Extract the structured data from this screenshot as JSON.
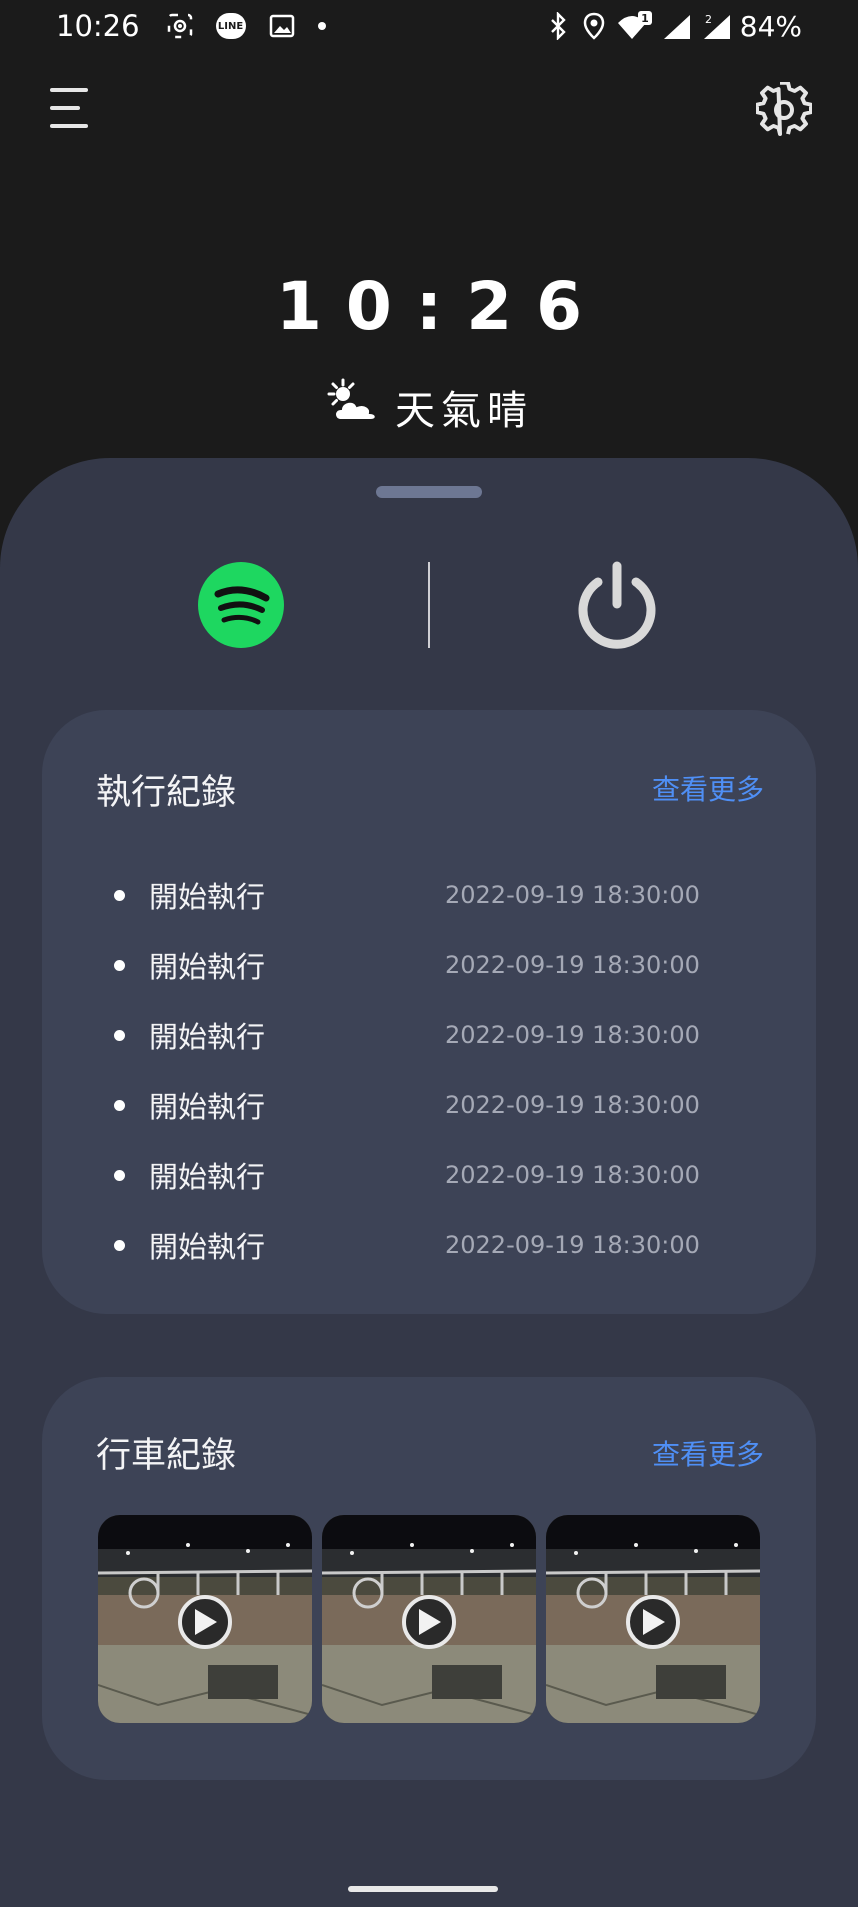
{
  "status_bar": {
    "time": "10:26",
    "battery": "84%",
    "line_label": "LINE",
    "sim1_badge": "1",
    "sim2_badge": "2",
    "left_icons": [
      "screenshot-icon",
      "line-icon",
      "gallery-icon",
      "dot-icon"
    ],
    "right_icons": [
      "bluetooth-icon",
      "location-icon",
      "wifi-icon",
      "signal-icon",
      "signal-icon"
    ]
  },
  "header": {
    "menu_icon": "menu-icon",
    "settings_icon": "gear-icon"
  },
  "clock": {
    "time": "10:26"
  },
  "weather": {
    "icon": "partly-sunny-icon",
    "text": "天氣晴"
  },
  "quick_actions": {
    "music_icon": "spotify-icon",
    "power_icon": "power-icon",
    "colors": {
      "spotify": "#1ed760",
      "power": "#d9d9d9"
    }
  },
  "execution_log": {
    "title": "執行紀錄",
    "more_label": "查看更多",
    "items": [
      {
        "action": "開始執行",
        "time": "2022-09-19 18:30:00"
      },
      {
        "action": "開始執行",
        "time": "2022-09-19 18:30:00"
      },
      {
        "action": "開始執行",
        "time": "2022-09-19 18:30:00"
      },
      {
        "action": "開始執行",
        "time": "2022-09-19 18:30:00"
      },
      {
        "action": "開始執行",
        "time": "2022-09-19 18:30:00"
      },
      {
        "action": "開始執行",
        "time": "2022-09-19 18:30:00"
      }
    ]
  },
  "driving_log": {
    "title": "行車紀錄",
    "more_label": "查看更多",
    "videos": [
      {
        "icon": "play-icon"
      },
      {
        "icon": "play-icon"
      },
      {
        "icon": "play-icon"
      }
    ]
  },
  "colors": {
    "background": "#1b1b1b",
    "sheet": "#343848",
    "card": "#3d4356",
    "accent_link": "#4f8ff5"
  }
}
